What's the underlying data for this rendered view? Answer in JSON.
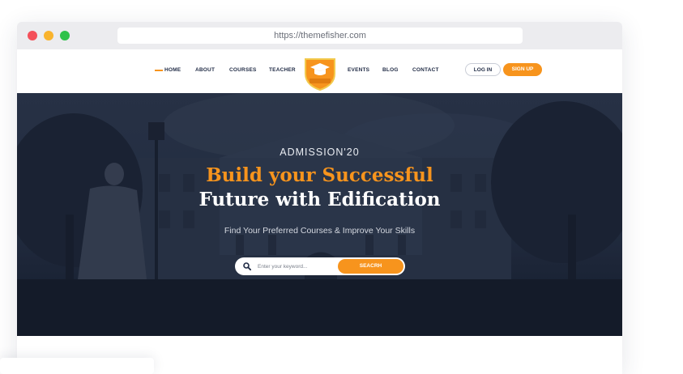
{
  "browser": {
    "url": "https://themefisher.com"
  },
  "nav": {
    "items": [
      {
        "label": "HOME",
        "active": true
      },
      {
        "label": "ABOUT"
      },
      {
        "label": "COURSES"
      },
      {
        "label": "TEACHER"
      },
      {
        "label": "EVENTS"
      },
      {
        "label": "BLOG"
      },
      {
        "label": "CONTACT"
      }
    ],
    "login_label": "LOG IN",
    "signup_label": "SIGN UP",
    "logo_icon": "graduation-cap-shield-logo"
  },
  "hero": {
    "eyebrow": "ADMISSION'20",
    "title_line1": "Build your Successful",
    "title_line2": "Future with Edification",
    "subtitle": "Find Your Preferred Courses & Improve Your Skills",
    "search": {
      "placeholder": "Enter your keyword...",
      "button_label": "SEACRH"
    }
  },
  "colors": {
    "accent": "#f7941d",
    "navy": "#1f2a44",
    "hero_overlay": "#1d2636"
  }
}
